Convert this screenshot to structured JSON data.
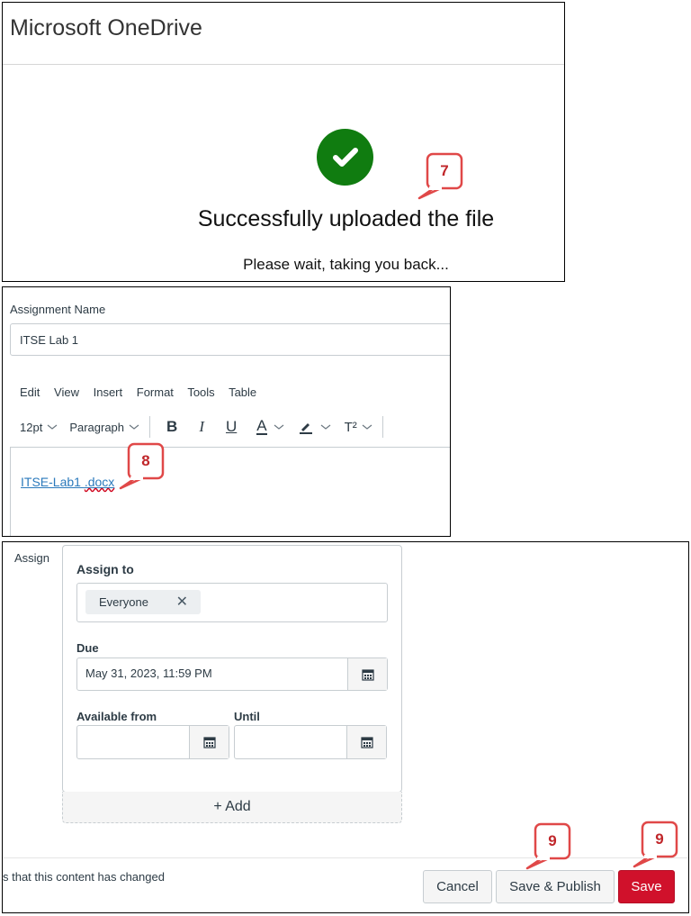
{
  "onedrive": {
    "title": "Microsoft OneDrive",
    "success_message": "Successfully uploaded the file",
    "wait_message": "Please wait, taking you back...",
    "success_color": "#107c10"
  },
  "callouts": {
    "step7": "7",
    "step8": "8",
    "step9a": "9",
    "step9b": "9",
    "color": "#c0262a"
  },
  "assignment": {
    "name_label": "Assignment Name",
    "name_value": "ITSE Lab 1",
    "menu": [
      "Edit",
      "View",
      "Insert",
      "Format",
      "Tools",
      "Table"
    ],
    "toolbar": {
      "font_size": "12pt",
      "block_format": "Paragraph",
      "bold": "B",
      "italic": "I",
      "underline": "U",
      "text_color": "A",
      "superscript": "T²"
    },
    "file_link": {
      "part1": "ITSE-Lab1 ",
      "part2": ".docx"
    }
  },
  "assign": {
    "section_label": "Assign",
    "assign_to_label": "Assign to",
    "assignee_chip": "Everyone",
    "chip_remove": "✕",
    "due_label": "Due",
    "due_value": "May 31, 2023, 11:59 PM",
    "available_from_label": "Available from",
    "until_label": "Until",
    "available_from_value": "",
    "until_value": "",
    "add_button": "+ Add"
  },
  "footer": {
    "notify_text": "s that this content has changed",
    "cancel": "Cancel",
    "save_publish": "Save & Publish",
    "save": "Save",
    "primary_color": "#d0112b"
  }
}
